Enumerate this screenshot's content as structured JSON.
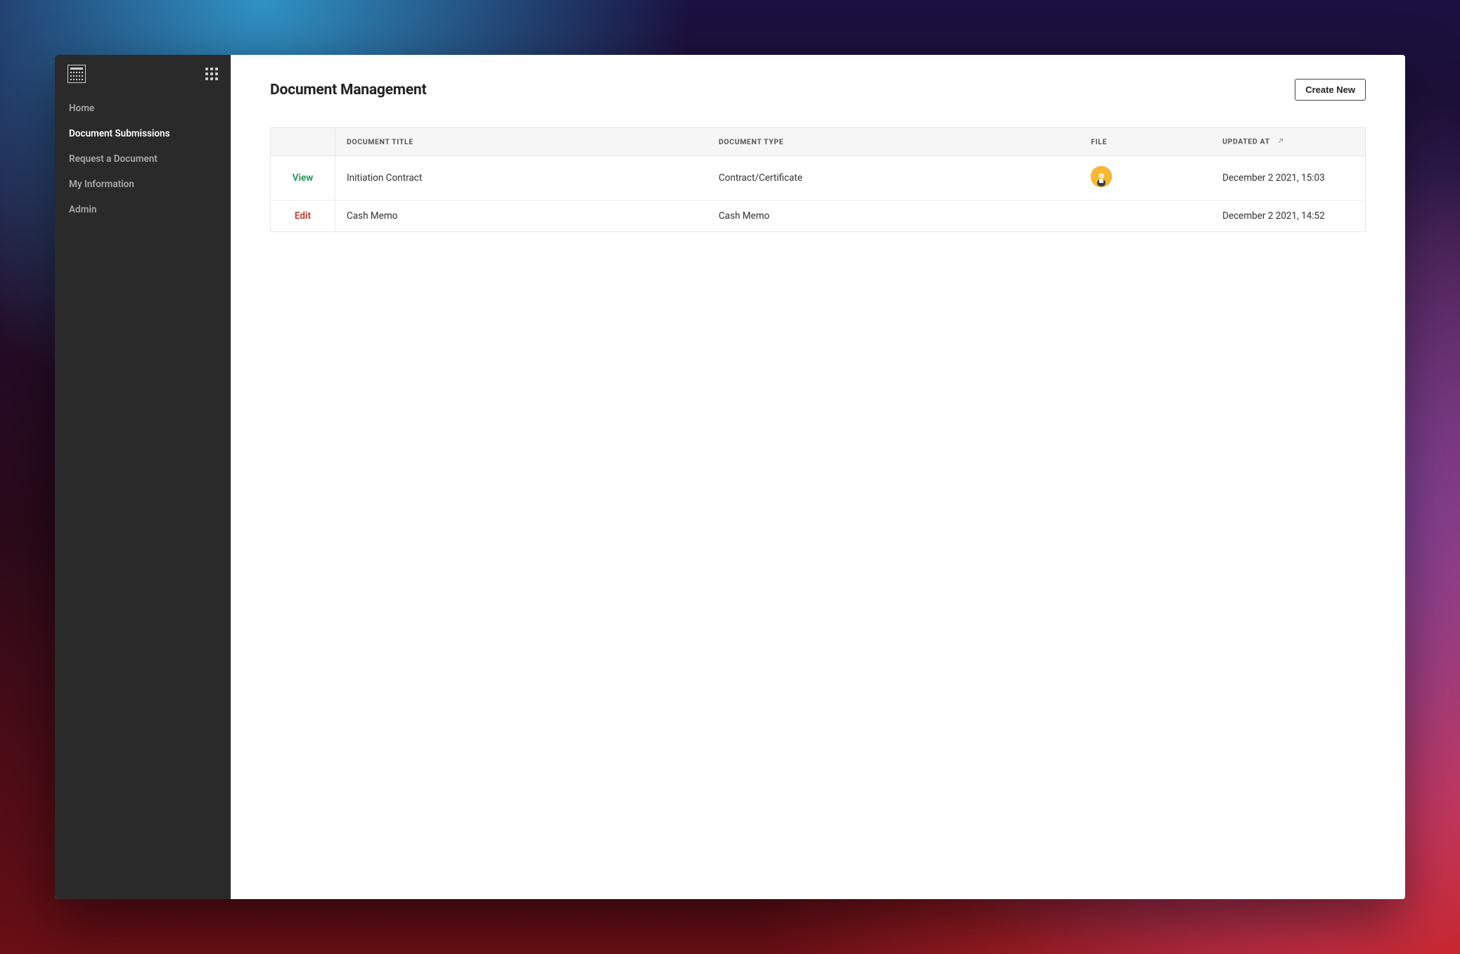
{
  "sidebar": {
    "items": [
      {
        "label": "Home",
        "active": false
      },
      {
        "label": "Document Submissions",
        "active": true
      },
      {
        "label": "Request a Document",
        "active": false
      },
      {
        "label": "My Information",
        "active": false
      },
      {
        "label": "Admin",
        "active": false
      }
    ]
  },
  "header": {
    "title": "Document Management",
    "create_label": "Create New"
  },
  "table": {
    "columns": {
      "action": "",
      "title": "Document Title",
      "type": "Document Type",
      "file": "File",
      "updated": "Updated At"
    },
    "rows": [
      {
        "action_label": "View",
        "action_kind": "view",
        "title": "Initiation Contract",
        "type": "Contract/Certificate",
        "has_file": true,
        "updated": "December 2 2021, 15:03"
      },
      {
        "action_label": "Edit",
        "action_kind": "edit",
        "title": "Cash Memo",
        "type": "Cash Memo",
        "has_file": false,
        "updated": "December 2 2021, 14:52"
      }
    ]
  }
}
